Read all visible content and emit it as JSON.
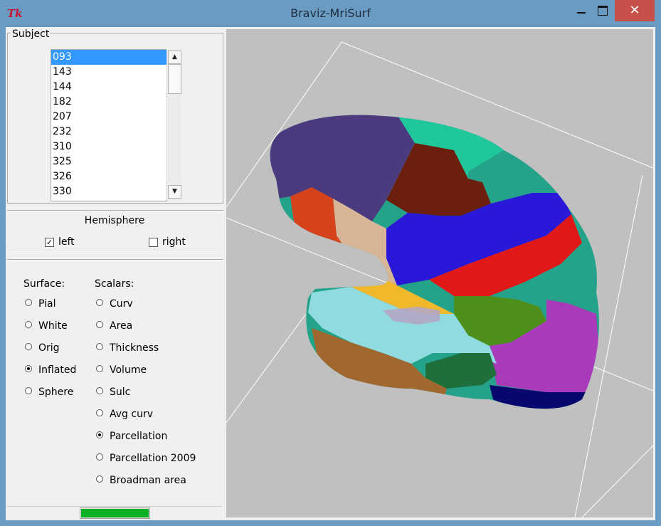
{
  "window": {
    "title": "Braviz-MriSurf",
    "app_icon": "Tk",
    "colors": {
      "titlebar": "#6a9bc3",
      "close_button": "#c7504a",
      "viewport_bg": "#c0c0c0",
      "progress": "#06b025"
    }
  },
  "subject": {
    "group_label": "Subject",
    "items": [
      "093",
      "143",
      "144",
      "182",
      "207",
      "232",
      "310",
      "325",
      "326",
      "330"
    ],
    "selected": "093"
  },
  "hemisphere": {
    "title": "Hemisphere",
    "left": {
      "label": "left",
      "checked": true
    },
    "right": {
      "label": "right",
      "checked": false
    }
  },
  "surface": {
    "heading": "Surface:",
    "options": [
      "Pial",
      "White",
      "Orig",
      "Inflated",
      "Sphere"
    ],
    "selected": "Inflated"
  },
  "scalars": {
    "heading": "Scalars:",
    "options": [
      "Curv",
      "Area",
      "Thickness",
      "Volume",
      "Sulc",
      "Avg curv",
      "Parcellation",
      "Parcellation 2009",
      "Broadman area"
    ],
    "selected": "Parcellation"
  },
  "progress": {
    "fraction": 1.0
  },
  "viewport": {
    "content": "inflated-brain-surface",
    "parcel_colors": [
      "#4b3a7e",
      "#6b1f0c",
      "#1fc79a",
      "#2a18d8",
      "#e01818",
      "#25a38a",
      "#d8b596",
      "#d5421c",
      "#f0b82a",
      "#4d8f1a",
      "#a93aba",
      "#1e6f3c",
      "#8fdbe0",
      "#a0672e",
      "#070770"
    ]
  }
}
